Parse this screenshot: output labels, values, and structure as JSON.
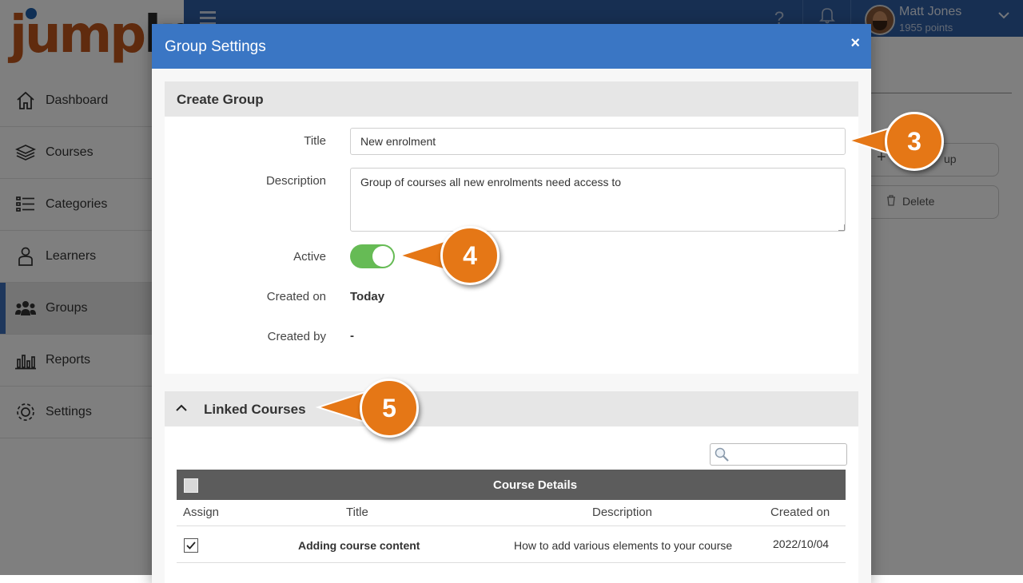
{
  "app": {
    "logo_text": "jump",
    "logo_text_rest": "lm",
    "sidebar": {
      "items": [
        {
          "label": "Dashboard",
          "icon": "home-icon"
        },
        {
          "label": "Courses",
          "icon": "stack-icon"
        },
        {
          "label": "Categories",
          "icon": "list-icon"
        },
        {
          "label": "Learners",
          "icon": "person-icon"
        },
        {
          "label": "Groups",
          "icon": "people-icon",
          "active": true
        },
        {
          "label": "Reports",
          "icon": "bar-chart-icon"
        },
        {
          "label": "Settings",
          "icon": "gear-icon"
        }
      ]
    },
    "topbar": {
      "help_glyph": "?",
      "user_name": "Matt Jones",
      "user_points": "1955 points"
    },
    "background_buttons": {
      "add_group_partial": "up",
      "delete": "Delete"
    }
  },
  "modal": {
    "title": "Group Settings",
    "close_glyph": "×",
    "create_group": {
      "heading": "Create Group",
      "title_label": "Title",
      "title_value": "New enrolment",
      "description_label": "Description",
      "description_value": "Group of courses all new enrolments need access to",
      "active_label": "Active",
      "active": true,
      "created_on_label": "Created on",
      "created_on_value": "Today",
      "created_by_label": "Created by",
      "created_by_value": "-"
    },
    "linked_courses": {
      "heading": "Linked Courses",
      "search_placeholder": "",
      "table_caption": "Course Details",
      "columns": [
        "Assign",
        "Title",
        "Description",
        "Created on"
      ],
      "rows": [
        {
          "assigned": true,
          "title": "Adding course content",
          "description": "How to add various elements to your course",
          "created_on": "2022/10/04"
        }
      ]
    }
  },
  "callouts": [
    "3",
    "4",
    "5"
  ],
  "colors": {
    "topbar": "#2e5ea4",
    "modal_header": "#3a76c4",
    "toggle_on": "#66bb55",
    "callout": "#e57716",
    "logo_orange": "#c0561d",
    "active_nav_bar": "#3c6fb8"
  }
}
